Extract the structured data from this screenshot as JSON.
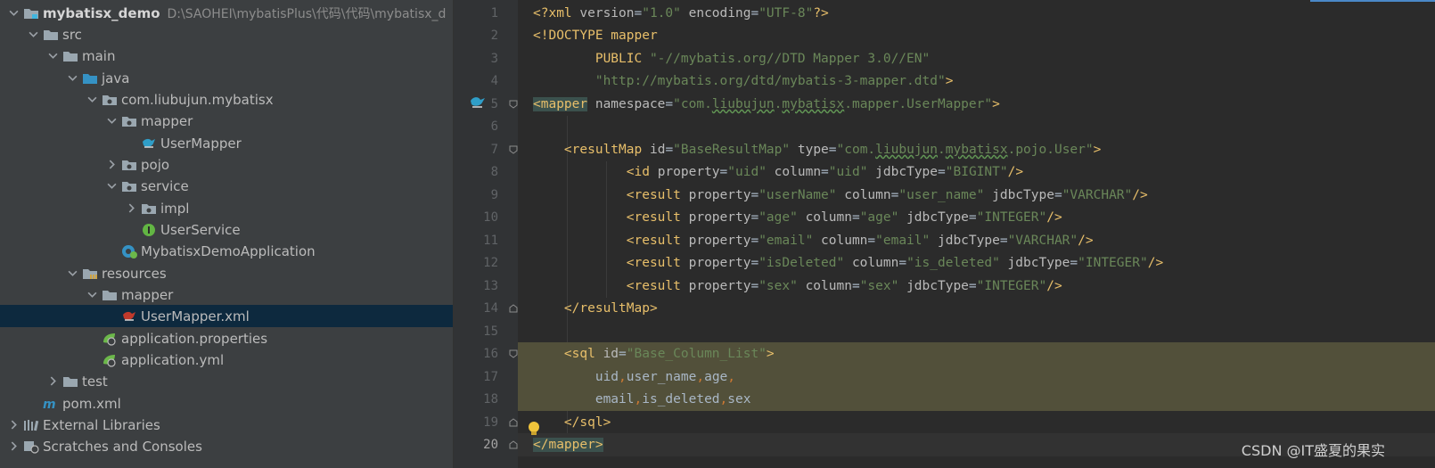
{
  "project": {
    "name": "mybatisx_demo",
    "path": "D:\\SAOHEI\\mybatisPlus\\代码\\代码\\mybatisx_d"
  },
  "tree": {
    "src": "src",
    "main": "main",
    "java": "java",
    "package": "com.liubujun.mybatisx",
    "mapper_pkg": "mapper",
    "user_mapper": "UserMapper",
    "pojo": "pojo",
    "service": "service",
    "impl": "impl",
    "user_service": "UserService",
    "app_class": "MybatisxDemoApplication",
    "resources": "resources",
    "res_mapper": "mapper",
    "user_mapper_xml": "UserMapper.xml",
    "app_props": "application.properties",
    "app_yml": "application.yml",
    "test": "test",
    "pom": "pom.xml",
    "external_libraries": "External Libraries",
    "scratches": "Scratches and Consoles"
  },
  "editor": {
    "line_numbers": [
      "1",
      "2",
      "3",
      "4",
      "5",
      "6",
      "7",
      "8",
      "9",
      "10",
      "11",
      "12",
      "13",
      "14",
      "15",
      "16",
      "17",
      "18",
      "19",
      "20"
    ],
    "line1": {
      "open": "<?xml ",
      "a1": "version",
      "eq1": "=",
      "v1": "\"1.0\"",
      "a2": " encoding",
      "eq2": "=",
      "v2": "\"UTF-8\"",
      "close": "?>"
    },
    "line2": {
      "text": "<!DOCTYPE mapper"
    },
    "line3": {
      "kw": "PUBLIC ",
      "str": "\"-//mybatis.org//DTD Mapper 3.0//EN\""
    },
    "line4": {
      "str": "\"http://mybatis.org/dtd/mybatis-3-mapper.dtd\"",
      "close": ">"
    },
    "line5": {
      "tag": "<mapper",
      "attr": " namespace",
      "eq": "=",
      "v_a": "\"com.",
      "v_b": "liubujun",
      "v_c": ".",
      "v_d": "mybatisx",
      "v_e": ".mapper.UserMapper\"",
      "close": ">"
    },
    "line7": {
      "tag": "<resultMap",
      "a1": " id",
      "eq1": "=",
      "v1": "\"BaseResultMap\"",
      "a2": " type",
      "eq2": "=",
      "v_a": "\"com.",
      "v_b": "liubujun",
      "v_c": ".",
      "v_d": "mybatisx",
      "v_e": ".pojo.User\"",
      "close": ">"
    },
    "line8": {
      "tag": "<id",
      "a1": " property",
      "v1": "\"uid\"",
      "a2": " column",
      "v2": "\"uid\"",
      "a3": " jdbcType",
      "v3": "\"BIGINT\"",
      "close": "/>"
    },
    "line9": {
      "tag": "<result",
      "a1": " property",
      "v1": "\"userName\"",
      "a2": " column",
      "v2": "\"user_name\"",
      "a3": " jdbcType",
      "v3": "\"VARCHAR\"",
      "close": "/>"
    },
    "line10": {
      "tag": "<result",
      "a1": " property",
      "v1": "\"age\"",
      "a2": " column",
      "v2": "\"age\"",
      "a3": " jdbcType",
      "v3": "\"INTEGER\"",
      "close": "/>"
    },
    "line11": {
      "tag": "<result",
      "a1": " property",
      "v1": "\"email\"",
      "a2": " column",
      "v2": "\"email\"",
      "a3": " jdbcType",
      "v3": "\"VARCHAR\"",
      "close": "/>"
    },
    "line12": {
      "tag": "<result",
      "a1": " property",
      "v1": "\"isDeleted\"",
      "a2": " column",
      "v2": "\"is_deleted\"",
      "a3": " jdbcType",
      "v3": "\"INTEGER\"",
      "close": "/>"
    },
    "line13": {
      "tag": "<result",
      "a1": " property",
      "v1": "\"sex\"",
      "a2": " column",
      "v2": "\"sex\"",
      "a3": " jdbcType",
      "v3": "\"INTEGER\"",
      "close": "/>"
    },
    "line14": {
      "text": "</resultMap>"
    },
    "line16": {
      "tag": "<sql",
      "a1": " id",
      "eq": "=",
      "v1": "\"Base_Column_List\"",
      "close": ">"
    },
    "line17": {
      "c1": "uid",
      "p1": ",",
      "c2": "user_name",
      "p2": ",",
      "c3": "age",
      "p3": ","
    },
    "line18": {
      "c1": "email",
      "p1": ",",
      "c2": "is_deleted",
      "p2": ",",
      "c3": "sex"
    },
    "line19": {
      "text": "</sql>"
    },
    "line20": {
      "text": "</mapper>"
    }
  },
  "watermark": "CSDN @IT盛夏的果实"
}
